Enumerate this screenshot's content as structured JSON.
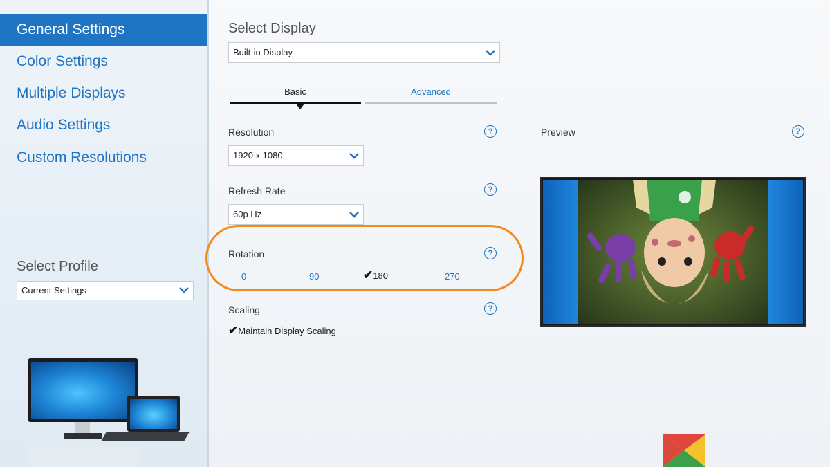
{
  "sidebar": {
    "items": [
      {
        "label": "General Settings",
        "active": true
      },
      {
        "label": "Color Settings",
        "active": false
      },
      {
        "label": "Multiple Displays",
        "active": false
      },
      {
        "label": "Audio Settings",
        "active": false
      },
      {
        "label": "Custom Resolutions",
        "active": false
      }
    ],
    "profile": {
      "title": "Select Profile",
      "value": "Current Settings"
    }
  },
  "main": {
    "select_display": {
      "title": "Select Display",
      "value": "Built-in Display"
    },
    "tabs": [
      {
        "label": "Basic",
        "active": true
      },
      {
        "label": "Advanced",
        "active": false
      }
    ],
    "resolution": {
      "label": "Resolution",
      "value": "1920 x 1080"
    },
    "refresh_rate": {
      "label": "Refresh Rate",
      "value": "60p Hz"
    },
    "rotation": {
      "label": "Rotation",
      "options": [
        "0",
        "90",
        "180",
        "270"
      ],
      "selected": "180"
    },
    "scaling": {
      "label": "Scaling",
      "option": "Maintain Display Scaling",
      "checked": true
    },
    "preview": {
      "label": "Preview"
    },
    "help_glyph": "?"
  },
  "colors": {
    "accent": "#1f74c4",
    "highlight": "#f28a1c"
  }
}
